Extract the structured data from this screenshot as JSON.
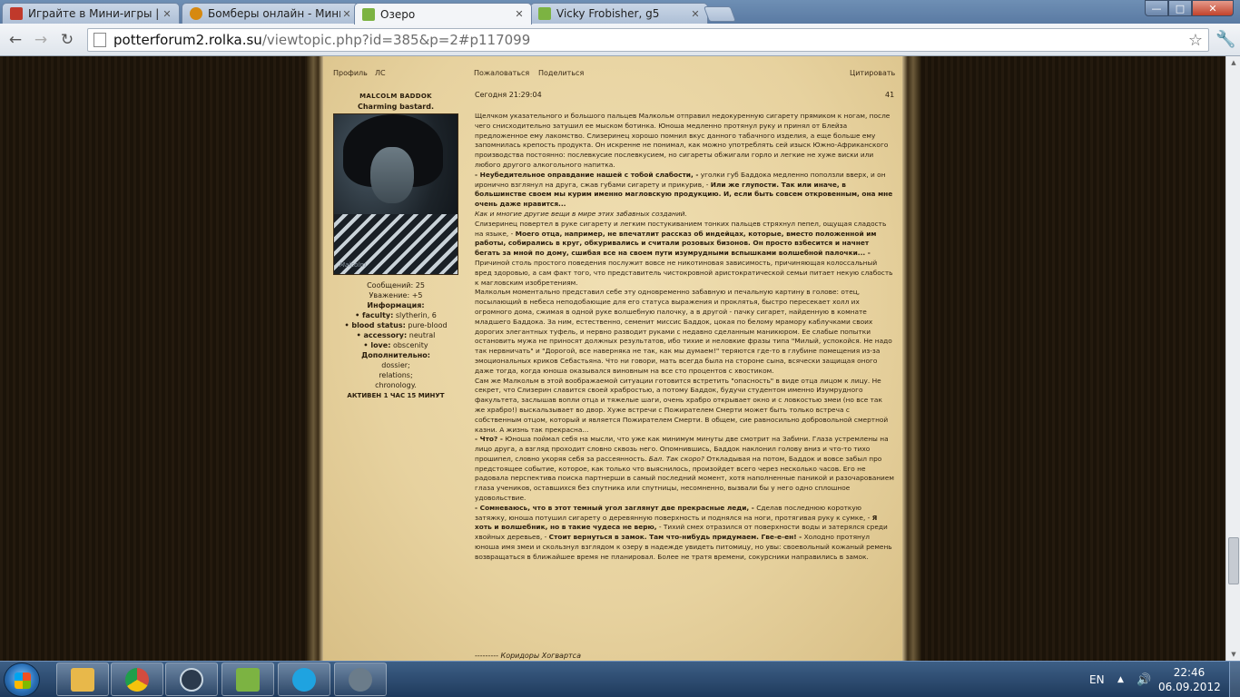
{
  "browser": {
    "tabs": [
      {
        "label": "Играйте в Мини-игры | бо",
        "favicon_color": "#c0392b"
      },
      {
        "label": "Бомберы онлайн - Мини",
        "favicon_color": "#d68910"
      },
      {
        "label": "Озеро",
        "favicon_color": "#7cb342"
      },
      {
        "label": "Vicky Frobisher, g5",
        "favicon_color": "#7cb342"
      }
    ],
    "window_buttons": {
      "minimize": "—",
      "maximize": "□",
      "close": "✕"
    },
    "address": {
      "host": "potterforum2.rolka.su",
      "path": "/viewtopic.php?id=385&p=2#p117099"
    }
  },
  "post": {
    "links_left": [
      "Профиль",
      "ЛС"
    ],
    "links_mid": [
      "Пожаловаться",
      "Поделиться"
    ],
    "quote_label": "Цитировать",
    "date": "Сегодня 21:29:04",
    "number": "41",
    "author": {
      "name": "MALCOLM BADDOK",
      "title": "Charming bastard.",
      "avatar_signature": "Malcolm",
      "messages": "Сообщений: 25",
      "respect": "Уважение: +5",
      "info_header": "Информация:",
      "faculty_label": "• faculty:",
      "faculty_value": " slytherin, 6",
      "blood_label": "• blood status:",
      "blood_value": " pure-blood",
      "accessory_label": "• accessory:",
      "accessory_value": " neutral",
      "love_label": "• love:",
      "love_value": " obscenity",
      "extra_header": "Дополнительно:",
      "extra_1": "dossier;",
      "extra_2": "relations;",
      "extra_3": "chronology.",
      "activity": "АКТИВЕН 1 ЧАС 15 МИНУТ"
    },
    "body": {
      "p1": "Щелчком указательного и большого пальцев Малкольм отправил недокуренную сигарету прямиком к ногам, после чего снисходительно затушил ее мыском ботинка. Юноша медленно протянул руку и принял от Блейза предложенное ему лакомство. Слизеринец хорошо помнил вкус данного табачного изделия, а еще больше ему запомнилась крепость продукта. Он искренне не понимал, как можно употреблять сей изыск Южно-Африканского производства постоянно: послевкусие послевкусием, но сигареты обжигали горло и легкие не хуже виски или любого другого алкогольного напитка.",
      "p2_b1": "- Неубедительное оправдание нашей с тобой слабости, -",
      "p2_t1": " уголки губ Баддока медленно поползли вверх, и он иронично взглянул на друга, сжав губами сигарету и прикурив, - ",
      "p2_b2": "Или же глупости. Так или иначе, в большинстве своем мы курим именно магловскую продукцию. И, если быть совсем откровенным, она мне очень даже нравится...",
      "p3_i": "Как и многие другие вещи в мире этих забавных созданий.",
      "p4_t1": "Слизеринец повертел в руке сигарету и легким постукиванием тонких пальцев стряхнул пепел, ощущая сладость на языке, - ",
      "p4_b1": "Моего отца, например, не впечатлит рассказ об индейцах, которые, вместо положенной им работы, собирались в круг, обкуривались и считали розовых бизонов. Он просто взбесится и начнет бегать за мной по дому, сшибая все на своем пути изумрудными вспышками волшебной палочки... -",
      "p4_t2": " Причиной столь простого поведения послужит вовсе не никотиновая зависимость, причиняющая колоссальный вред здоровью, а сам факт того, что представитель чистокровной аристократической семьи питает некую слабость к магловским изобретениям.",
      "p5": "Малкольм моментально представил себе эту одновременно забавную и печальную картину в голове: отец, посылающий в небеса неподобающие для его статуса выражения и проклятья, быстро пересекает холл их огромного дома, сжимая в одной руке волшебную палочку, а в другой - пачку сигарет, найденную в комнате младшего Баддока. За ним, естественно, семенит миссис Баддок, цокая по белому мрамору каблучками своих дорогих элегантных туфель, и нервно разводит руками с недавно сделанным маникюром. Ее слабые попытки остановить мужа не приносят должных результатов, ибо тихие и неловкие фразы типа \"Милый, успокойся. Не надо так нервничать\" и \"Дорогой, все наверняка не так, как мы думаем!\" теряются где-то в глубине помещения из-за эмоциональных криков Себастьяна. Что ни говори, мать всегда была на стороне сына, всячески защищая оного даже тогда, когда юноша оказывался виновным на все сто процентов с хвостиком.",
      "p6": "Сам же Малкольм в этой воображаемой ситуации готовится встретить \"опасность\" в виде отца лицом к лицу. Не секрет, что Слизерин славится своей храбростью, а потому Баддок, будучи студентом именно Изумрудного факультета, заслышав вопли отца и тяжелые шаги, очень храбро открывает окно и с ловкостью змеи (но все так же храбро!) выскальзывает во двор. Хуже встречи с Пожирателем Смерти может быть только встреча с собственным отцом, который и является Пожирателем Смерти. В общем, сие равносильно добровольной смертной казни. А жизнь так прекрасна...",
      "p7_b1": "- Что? -",
      "p7_t1": " Юноша поймал себя на мысли, что уже как минимум минуты две смотрит на Забини. Глаза устремлены на лицо друга, а взгляд проходит словно сквозь него. Опомнившись, Баддок наклонил голову вниз и что-то тихо прошипел, словно укоряя себя за рассеянность. ",
      "p7_i1": "Бал. Так скоро?",
      "p7_t2": " Откладывая на потом, Баддок и вовсе забыл про предстоящее событие, которое, как только что выяснилось, произойдет всего через несколько часов. Его не радовала перспектива поиска партнерши в самый последний момент, хотя наполненные паникой и разочарованием глаза учеников, оставшихся без спутника или спутницы, несомненно, вызвали бы у него одно сплошное удовольствие.",
      "p8_b1": "- Сомневаюсь, что в этот темный угол заглянут две прекрасные леди, -",
      "p8_t1": " Сделав последнюю короткую затяжку, юноша потушил сигарету о деревянную поверхность и поднялся на ноги, протягивая руку к сумке, - ",
      "p8_b2": "Я хоть и волшебник, но в такие чудеса не верю,",
      "p8_t2": " - Тихий смех отразился от поверхности воды и затерялся среди хвойных деревьев, - ",
      "p8_b3": "Стоит вернуться в замок. Там что-нибудь придумаем. Гве-е-ен! -",
      "p8_t3": " Холодно протянул юноша имя змеи и скользнул взглядом к озеру в надежде увидеть питомицу, но увы: своевольный кожаный ремень возвращаться в ближайшее время не планировал. Более не тратя времени, сокурсники направились в замок.",
      "footer_dashes": "--------- ",
      "footer_link": "Коридоры Хогвартса"
    }
  },
  "taskbar": {
    "language": "EN",
    "time": "22:46",
    "date": "06.09.2012",
    "apps": [
      {
        "name": "explorer",
        "color": "#e8b84a"
      },
      {
        "name": "chrome",
        "color": "#d24c3f"
      },
      {
        "name": "steam",
        "color": "#2b3a4d"
      },
      {
        "name": "winamp",
        "color": "#7cb342"
      },
      {
        "name": "skype",
        "color": "#1fa3e0"
      },
      {
        "name": "ventrilo",
        "color": "#6b7c8a"
      }
    ]
  }
}
